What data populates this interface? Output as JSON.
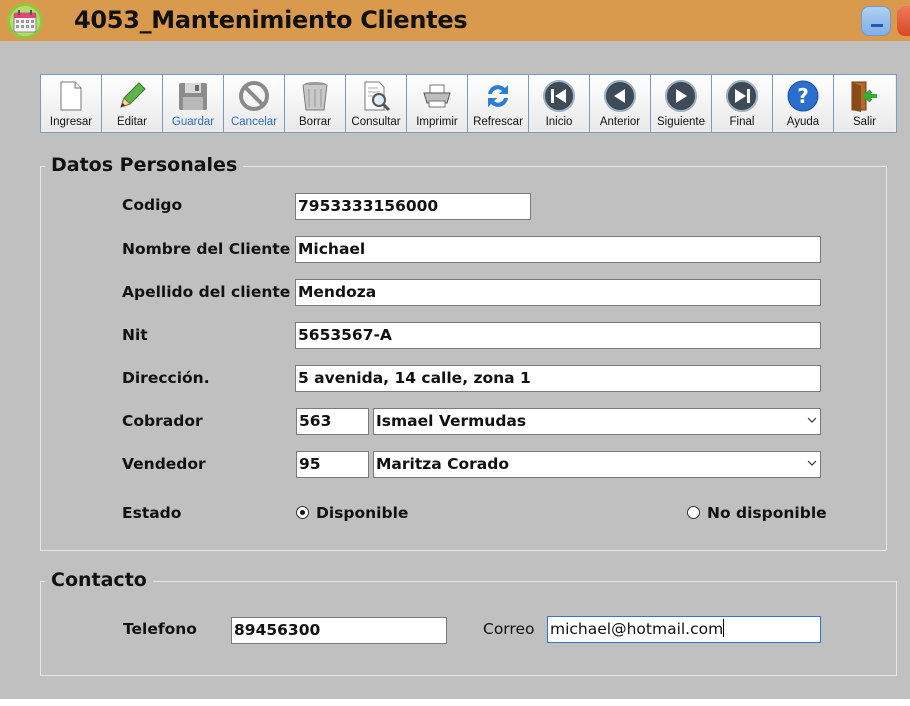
{
  "window": {
    "title": "4053_Mantenimiento Clientes"
  },
  "toolbar": {
    "buttons": [
      {
        "label": "Ingresar",
        "icon": "new-document-icon",
        "enabled": true
      },
      {
        "label": "Editar",
        "icon": "pencil-icon",
        "enabled": true
      },
      {
        "label": "Guardar",
        "icon": "save-disk-icon",
        "enabled": false
      },
      {
        "label": "Cancelar",
        "icon": "cancel-icon",
        "enabled": false
      },
      {
        "label": "Borrar",
        "icon": "trash-icon",
        "enabled": true
      },
      {
        "label": "Consultar",
        "icon": "search-document-icon",
        "enabled": true
      },
      {
        "label": "Imprimir",
        "icon": "printer-icon",
        "enabled": true
      },
      {
        "label": "Refrescar",
        "icon": "refresh-icon",
        "enabled": true
      },
      {
        "label": "Inicio",
        "icon": "first-record-icon",
        "enabled": true
      },
      {
        "label": "Anterior",
        "icon": "previous-record-icon",
        "enabled": true
      },
      {
        "label": "Siguiente",
        "icon": "next-record-icon",
        "enabled": true
      },
      {
        "label": "Final",
        "icon": "last-record-icon",
        "enabled": true
      },
      {
        "label": "Ayuda",
        "icon": "help-icon",
        "enabled": true
      },
      {
        "label": "Salir",
        "icon": "exit-door-icon",
        "enabled": true
      }
    ]
  },
  "personal": {
    "title": "Datos Personales",
    "codigo_label": "Codigo",
    "codigo": "7953333156000",
    "nombre_label": "Nombre del Cliente",
    "nombre": "Michael",
    "apellido_label": "Apellido del cliente",
    "apellido": "Mendoza",
    "nit_label": "Nit",
    "nit": "5653567-A",
    "direccion_label": "Dirección.",
    "direccion": "5 avenida, 14 calle, zona 1",
    "cobrador_label": "Cobrador",
    "cobrador_code": "563",
    "cobrador_name": "Ismael Vermudas",
    "vendedor_label": "Vendedor",
    "vendedor_code": "95",
    "vendedor_name": "Maritza Corado",
    "estado_label": "Estado",
    "estado_opt1": "Disponible",
    "estado_opt2": "No disponible",
    "estado_selected": "Disponible"
  },
  "contact": {
    "title": "Contacto",
    "telefono_label": "Telefono",
    "telefono": "89456300",
    "correo_label": "Correo",
    "correo": "michael@hotmail.com"
  },
  "colors": {
    "titlebar": "#d99a4e",
    "client_bg": "#c0c0c0",
    "disabled_label": "#2d6cc2",
    "toolbar_border": "#7b9ac2"
  }
}
